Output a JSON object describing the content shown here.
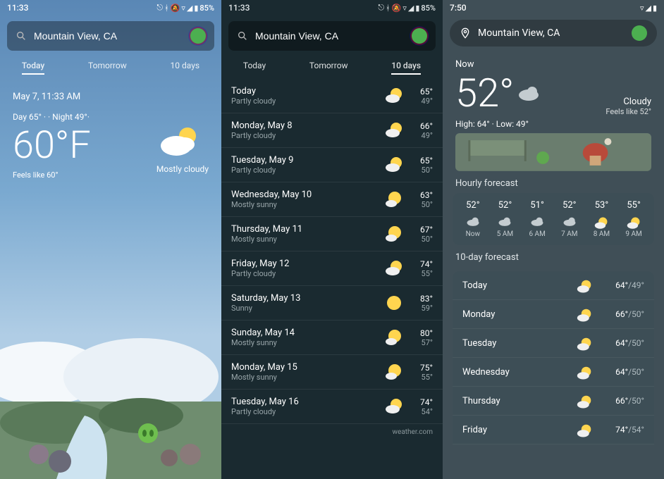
{
  "screen1": {
    "status_time": "11:33",
    "status_right": "85%",
    "search_value": "Mountain View, CA",
    "tabs": {
      "today": "Today",
      "tomorrow": "Tomorrow",
      "tendays": "10 days"
    },
    "date": "May 7, 11:33 AM",
    "range_day": "Day 65° ·",
    "range_night": "· Night 49°·",
    "temp": "60°F",
    "feels": "Feels like 60°",
    "condition": "Mostly cloudy"
  },
  "screen2": {
    "status_time": "11:33",
    "status_right": "85%",
    "search_value": "Mountain View, CA",
    "tabs": {
      "today": "Today",
      "tomorrow": "Tomorrow",
      "tendays": "10 days"
    },
    "forecast": [
      {
        "day": "Today",
        "cond": "Partly cloudy",
        "icon": "partly",
        "hi": "65°",
        "lo": "49°"
      },
      {
        "day": "Monday, May 8",
        "cond": "Partly cloudy",
        "icon": "partly",
        "hi": "66°",
        "lo": "49°"
      },
      {
        "day": "Tuesday, May 9",
        "cond": "Partly cloudy",
        "icon": "partly",
        "hi": "65°",
        "lo": "50°"
      },
      {
        "day": "Wednesday, May 10",
        "cond": "Mostly sunny",
        "icon": "mostsun",
        "hi": "63°",
        "lo": "50°"
      },
      {
        "day": "Thursday, May 11",
        "cond": "Mostly sunny",
        "icon": "mostsun",
        "hi": "67°",
        "lo": "50°"
      },
      {
        "day": "Friday, May 12",
        "cond": "Partly cloudy",
        "icon": "partly",
        "hi": "74°",
        "lo": "55°"
      },
      {
        "day": "Saturday, May 13",
        "cond": "Sunny",
        "icon": "sunny",
        "hi": "83°",
        "lo": "59°"
      },
      {
        "day": "Sunday, May 14",
        "cond": "Mostly sunny",
        "icon": "mostsun",
        "hi": "80°",
        "lo": "57°"
      },
      {
        "day": "Monday, May 15",
        "cond": "Mostly sunny",
        "icon": "mostsun",
        "hi": "75°",
        "lo": "55°"
      },
      {
        "day": "Tuesday, May 16",
        "cond": "Partly cloudy",
        "icon": "partly",
        "hi": "74°",
        "lo": "54°"
      }
    ],
    "attribution": "weather.com"
  },
  "screen3": {
    "status_time": "7:50",
    "location": "Mountain View, CA",
    "now_label": "Now",
    "temp": "52°",
    "condition": "Cloudy",
    "feels": "Feels like 52°",
    "hilo": "High: 64° · Low: 49°",
    "hourly_label": "Hourly forecast",
    "hourly": [
      {
        "temp": "52°",
        "label": "Now",
        "icon": "cloud"
      },
      {
        "temp": "52°",
        "label": "5 AM",
        "icon": "cloud"
      },
      {
        "temp": "51°",
        "label": "6 AM",
        "icon": "cloud"
      },
      {
        "temp": "52°",
        "label": "7 AM",
        "icon": "cloud"
      },
      {
        "temp": "53°",
        "label": "8 AM",
        "icon": "partly"
      },
      {
        "temp": "55°",
        "label": "9 AM",
        "icon": "partly"
      }
    ],
    "daily_label": "10-day forecast",
    "daily": [
      {
        "day": "Today",
        "hi": "64°",
        "lo": "49°",
        "icon": "partly"
      },
      {
        "day": "Monday",
        "hi": "66°",
        "lo": "50°",
        "icon": "partly"
      },
      {
        "day": "Tuesday",
        "hi": "64°",
        "lo": "50°",
        "icon": "partly"
      },
      {
        "day": "Wednesday",
        "hi": "64°",
        "lo": "50°",
        "icon": "partly"
      },
      {
        "day": "Thursday",
        "hi": "66°",
        "lo": "50°",
        "icon": "partly"
      },
      {
        "day": "Friday",
        "hi": "74°",
        "lo": "54°",
        "icon": "partly"
      }
    ]
  }
}
